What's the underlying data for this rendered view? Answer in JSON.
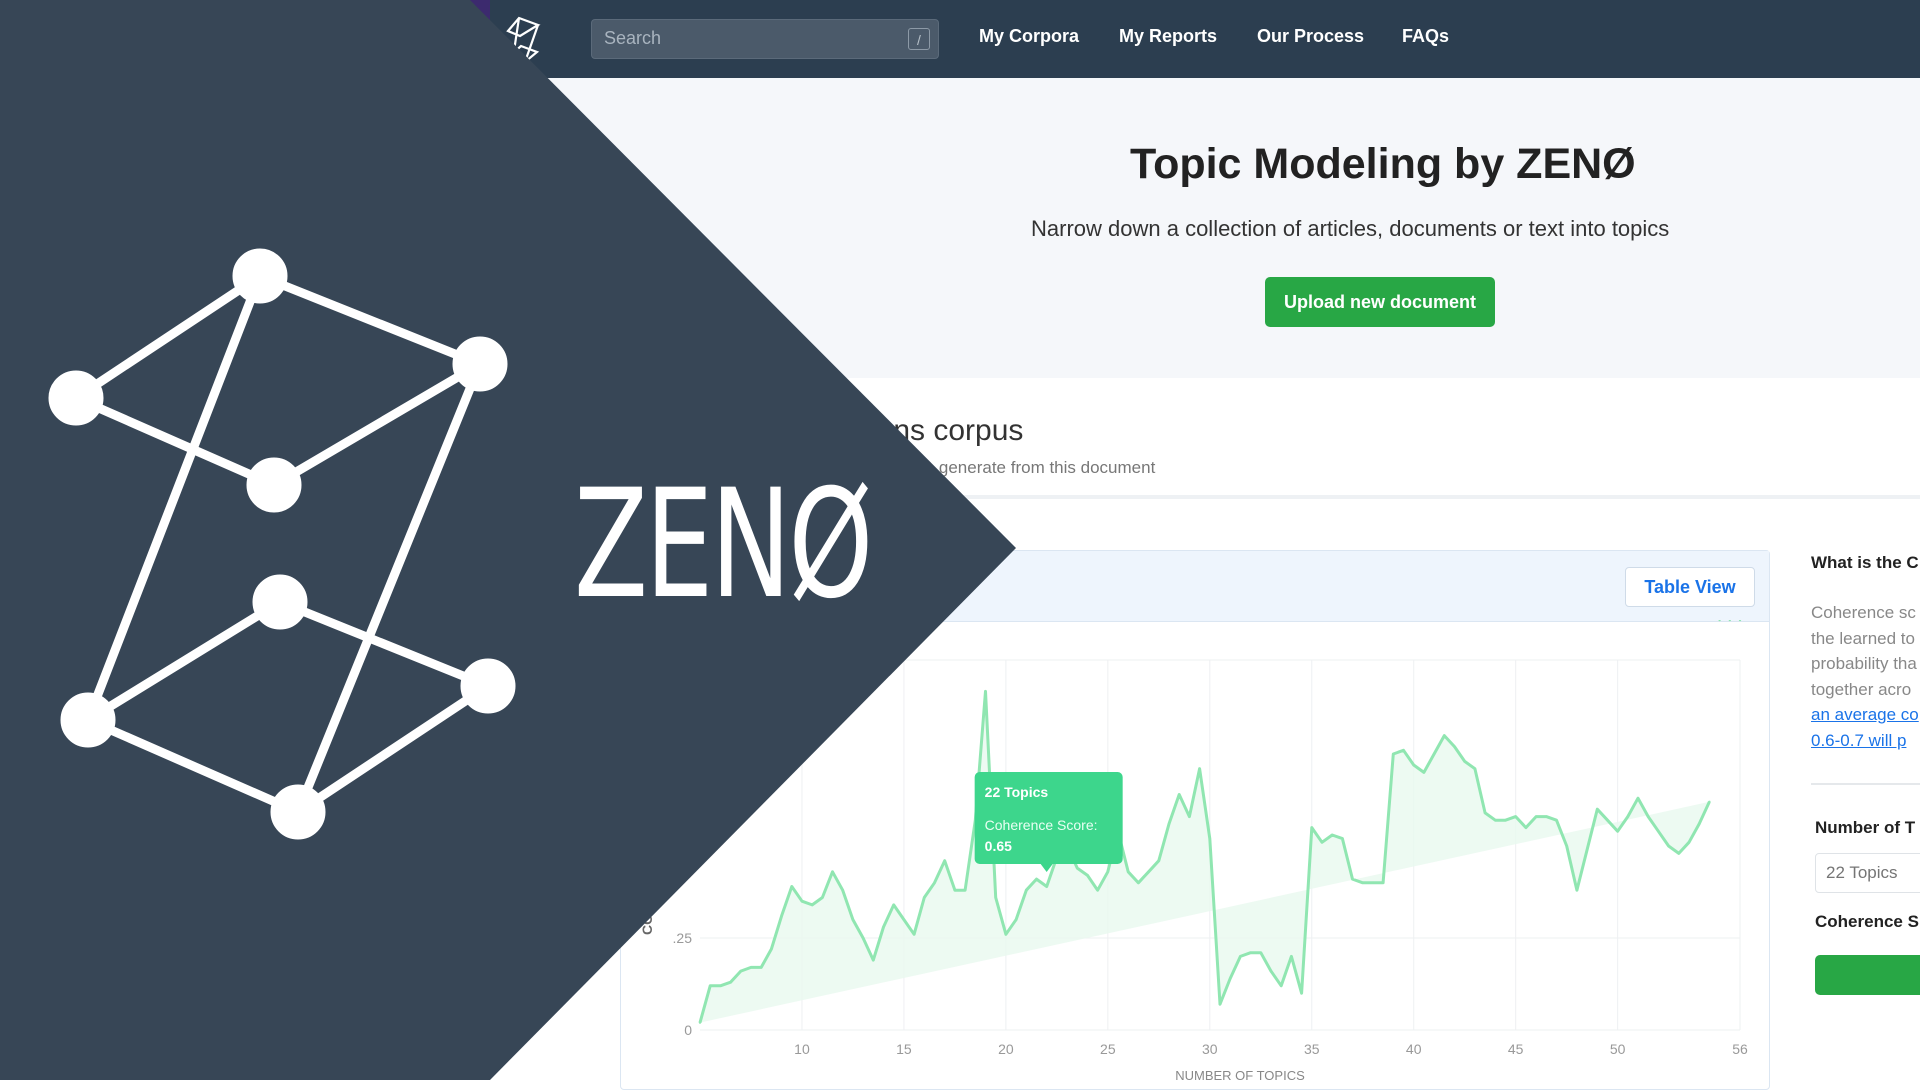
{
  "nav": {
    "search_placeholder": "Search",
    "search_shortcut": "/",
    "links": [
      "My Corpora",
      "My Reports",
      "Our Process",
      "FAQs"
    ]
  },
  "hero": {
    "title": "Topic Modeling by ZENØ",
    "subtitle": "Narrow down a collection of articles, documents or text into topics",
    "upload_label": "Upload new document"
  },
  "corpus": {
    "title_visible": "ions corpus",
    "subtitle_visible": "to generate from this document"
  },
  "chart_card": {
    "table_view_label": "Table View"
  },
  "side": {
    "question": "What is the C",
    "description_lines": [
      "Coherence sc",
      "the learned to",
      "probability tha",
      "together acro"
    ],
    "link_lines": [
      "an average co",
      "0.6-0.7 will p"
    ],
    "num_topics_label": "Number of T",
    "num_topics_value": "22 Topics",
    "coherence_label": "Coherence S"
  },
  "brand": {
    "word": "ZENØ"
  },
  "colors": {
    "nav_bg": "#2c3e50",
    "overlay_bg": "#374656",
    "accent_purple": "#3c2a6e",
    "green": "#28a745",
    "chart_line": "#90e6b1",
    "tooltip": "#3dd68c"
  },
  "chart_data": {
    "type": "area",
    "title": "",
    "xlabel": "NUMBER OF TOPICS",
    "ylabel": "CO",
    "xlim": [
      5,
      56
    ],
    "ylim": [
      0,
      0.5
    ],
    "x_ticks": [
      10,
      15,
      20,
      25,
      30,
      35,
      40,
      45,
      50,
      56
    ],
    "y_ticks": [
      0,
      0.25
    ],
    "y_tick_labels": [
      "0",
      ".25"
    ],
    "x": [
      5,
      5.5,
      6,
      6.5,
      7,
      7.5,
      8,
      8.5,
      9,
      9.5,
      10,
      10.5,
      11,
      11.5,
      12,
      12.5,
      13,
      13.5,
      14,
      14.5,
      15,
      15.5,
      16,
      16.5,
      17,
      17.5,
      18,
      18.5,
      19,
      19.5,
      20,
      20.5,
      21,
      21.5,
      22,
      22.5,
      23,
      23.5,
      24,
      24.5,
      25,
      25.5,
      26,
      26.5,
      27,
      27.5,
      28,
      28.5,
      29,
      29.5,
      30,
      30.5,
      31,
      31.5,
      32,
      32.5,
      33,
      33.5,
      34,
      34.5,
      35,
      35.5,
      36,
      36.5,
      37,
      37.5,
      38,
      38.5,
      39,
      39.5,
      40,
      40.5,
      41,
      41.5,
      42,
      42.5,
      43,
      43.5,
      44,
      44.5,
      45,
      45.5,
      46,
      46.5,
      47,
      47.5,
      48,
      48.5,
      49,
      49.5,
      50,
      50.5,
      51,
      51.5,
      52,
      52.5,
      53,
      53.5,
      54,
      54.5,
      55,
      55.5,
      56
    ],
    "values": [
      0.02,
      0.12,
      0.12,
      0.13,
      0.16,
      0.17,
      0.17,
      0.22,
      0.31,
      0.39,
      0.35,
      0.34,
      0.36,
      0.43,
      0.38,
      0.3,
      0.25,
      0.19,
      0.28,
      0.34,
      0.3,
      0.26,
      0.36,
      0.4,
      0.46,
      0.38,
      0.38,
      0.57,
      0.92,
      0.36,
      0.26,
      0.3,
      0.38,
      0.41,
      0.39,
      0.47,
      0.5,
      0.44,
      0.42,
      0.38,
      0.43,
      0.54,
      0.43,
      0.4,
      0.43,
      0.46,
      0.56,
      0.64,
      0.58,
      0.71,
      0.52,
      0.07,
      0.14,
      0.2,
      0.21,
      0.21,
      0.16,
      0.12,
      0.2,
      0.1,
      0.55,
      0.51,
      0.53,
      0.52,
      0.41,
      0.4,
      0.4,
      0.4,
      0.75,
      0.76,
      0.72,
      0.7,
      0.75,
      0.8,
      0.77,
      0.73,
      0.71,
      0.59,
      0.57,
      0.57,
      0.58,
      0.55,
      0.58,
      0.58,
      0.57,
      0.5,
      0.38,
      0.49,
      0.6,
      0.57,
      0.54,
      0.58,
      0.63,
      0.58,
      0.54,
      0.5,
      0.48,
      0.51,
      0.56,
      0.62
    ],
    "tooltip": {
      "title": "22 Topics",
      "label": "Coherence Score:",
      "value": "0.65"
    }
  }
}
